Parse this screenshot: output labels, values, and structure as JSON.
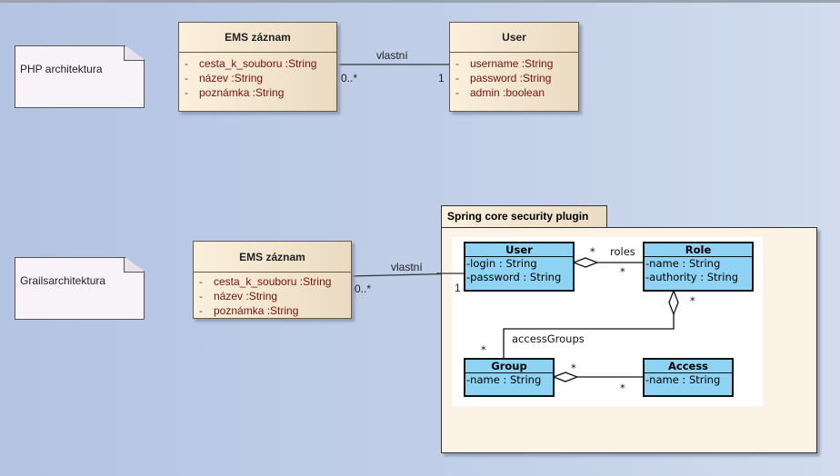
{
  "php": {
    "note": "PHP architektura",
    "ems": {
      "title": "EMS záznam",
      "attrs": [
        {
          "v": "-",
          "t": "cesta_k_souboru :String"
        },
        {
          "v": "-",
          "t": "název :String"
        },
        {
          "v": "-",
          "t": "poznámka :String"
        }
      ]
    },
    "user": {
      "title": "User",
      "attrs": [
        {
          "v": "-",
          "t": "username :String"
        },
        {
          "v": "-",
          "t": "password :String"
        },
        {
          "v": "-",
          "t": "admin :boolean"
        }
      ]
    },
    "assoc": {
      "label": "vlastní",
      "mult_from": "0..*",
      "mult_to": "1"
    }
  },
  "grails": {
    "note": "Grailsarchitektura",
    "ems": {
      "title": "EMS záznam",
      "attrs": [
        {
          "v": "-",
          "t": "cesta_k_souboru :String"
        },
        {
          "v": "-",
          "t": "název :String"
        },
        {
          "v": "-",
          "t": "poznámka :String"
        }
      ]
    },
    "assoc": {
      "label": "vlastní",
      "mult_from": "0..*",
      "mult_to": "1"
    }
  },
  "package": {
    "title": "Spring core security plugin",
    "user": {
      "title": "User",
      "attrs": [
        "-login : String",
        "-password : String"
      ]
    },
    "role": {
      "title": "Role",
      "attrs": [
        "-name : String",
        "-authority : String"
      ]
    },
    "group": {
      "title": "Group",
      "attrs": [
        "-name : String"
      ]
    },
    "access": {
      "title": "Access",
      "attrs": [
        "-name : String"
      ]
    },
    "roles_label": "roles",
    "access_groups_label": "accessGroups",
    "star": "*"
  },
  "colors": {
    "background": "#b3c4e2",
    "class_fill": "#f5e7cf",
    "attr_text": "#7a1010",
    "plugin_class_fill": "#8fd3f4"
  }
}
